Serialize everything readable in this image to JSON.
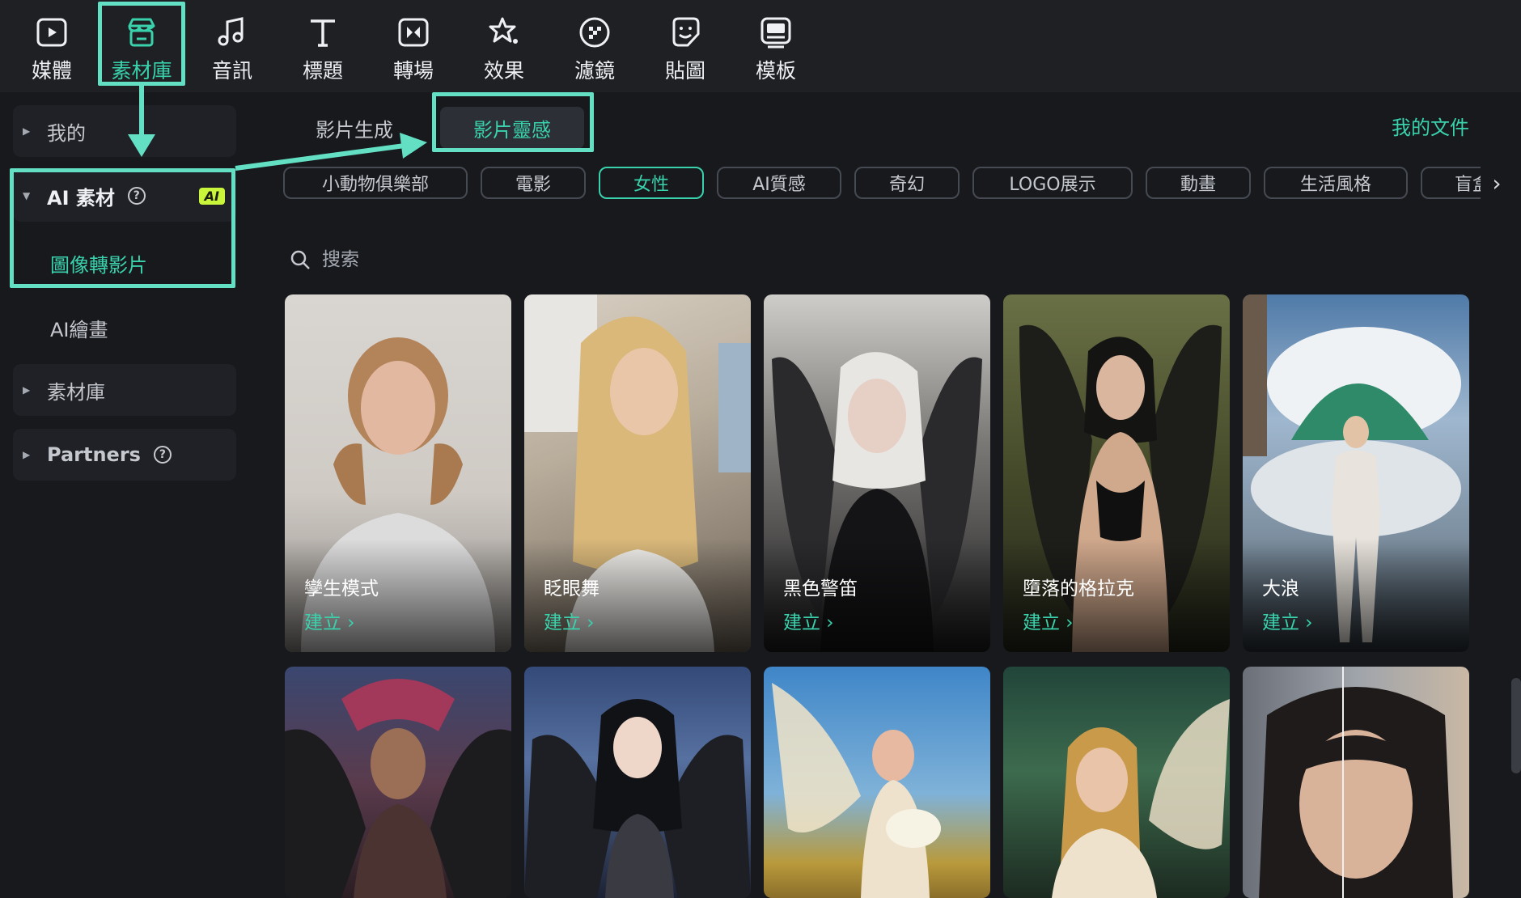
{
  "toolbar": {
    "items": [
      {
        "label": "媒體",
        "icon": "media-icon"
      },
      {
        "label": "素材庫",
        "icon": "store-icon"
      },
      {
        "label": "音訊",
        "icon": "music-note-icon"
      },
      {
        "label": "標題",
        "icon": "title-t-icon"
      },
      {
        "label": "轉場",
        "icon": "transition-icon"
      },
      {
        "label": "效果",
        "icon": "effects-star-icon"
      },
      {
        "label": "濾鏡",
        "icon": "filter-icon"
      },
      {
        "label": "貼圖",
        "icon": "sticker-icon"
      },
      {
        "label": "模板",
        "icon": "template-icon"
      }
    ],
    "active": "素材庫"
  },
  "sidebar": {
    "mine": "我的",
    "ai_materials": "AI 素材",
    "ai_badge": "AI",
    "image_to_video": "圖像轉影片",
    "ai_drawing": "AI繪畫",
    "library": "素材庫",
    "partners": "Partners",
    "help_glyph": "?"
  },
  "main": {
    "tabs": [
      "影片生成",
      "影片靈感"
    ],
    "active_tab": "影片靈感",
    "my_documents": "我的文件",
    "chips": [
      "小動物俱樂部",
      "電影",
      "女性",
      "AI質感",
      "奇幻",
      "LOGO展示",
      "動畫",
      "生活風格",
      "盲盒"
    ],
    "active_chip": "女性",
    "search_placeholder": "搜索",
    "cards_row1": [
      {
        "title": "孿生模式",
        "action": "建立 ›"
      },
      {
        "title": "眨眼舞",
        "action": "建立 ›"
      },
      {
        "title": "黑色警笛",
        "action": "建立 ›"
      },
      {
        "title": "墮落的格拉克",
        "action": "建立 ›"
      },
      {
        "title": "大浪",
        "action": "建立 ›"
      }
    ]
  },
  "colors": {
    "accent": "#3ad2ad",
    "annotation": "#63e0c4",
    "background": "#17191d",
    "toolbar": "#1e2024",
    "ai_badge": "#c9f53a"
  }
}
